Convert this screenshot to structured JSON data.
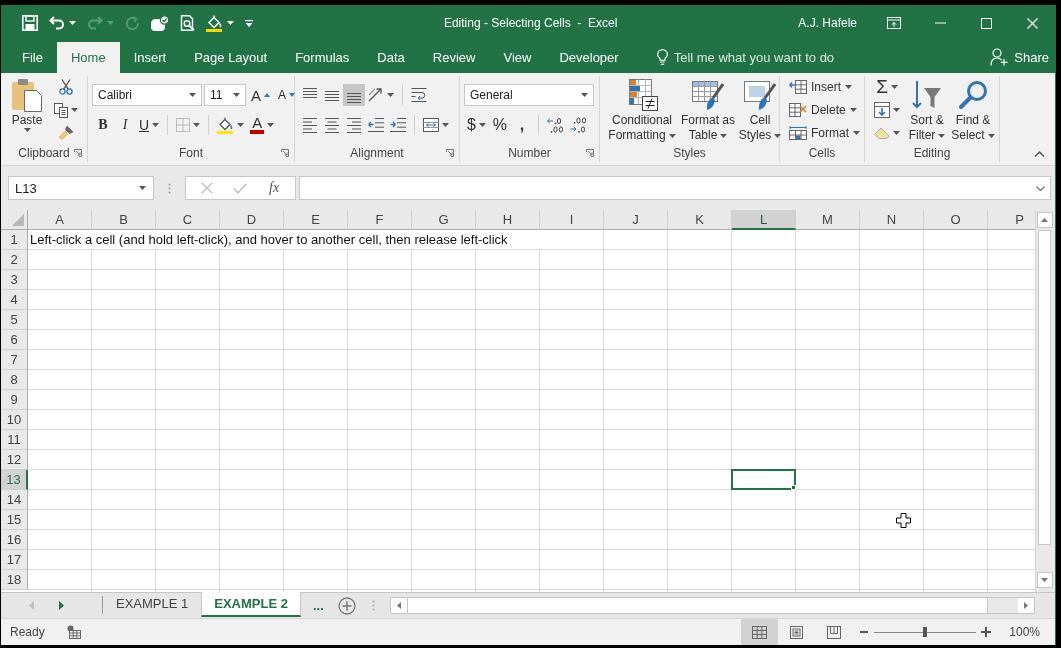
{
  "window": {
    "title": "Editing - Selecting Cells  -  Excel",
    "user": "A.J. Hafele"
  },
  "quick_access": [
    {
      "kind": "save",
      "disabled": false
    },
    {
      "kind": "undo",
      "disabled": false
    },
    {
      "kind": "redo",
      "disabled": true
    },
    {
      "kind": "repeat",
      "disabled": true
    },
    {
      "kind": "touch",
      "disabled": false
    },
    {
      "kind": "preview",
      "disabled": false
    },
    {
      "kind": "fill",
      "disabled": false
    },
    {
      "kind": "customize",
      "disabled": false
    }
  ],
  "ribbon_tabs": [
    {
      "label": "File",
      "selected": false
    },
    {
      "label": "Home",
      "selected": true
    },
    {
      "label": "Insert",
      "selected": false
    },
    {
      "label": "Page Layout",
      "selected": false
    },
    {
      "label": "Formulas",
      "selected": false
    },
    {
      "label": "Data",
      "selected": false
    },
    {
      "label": "Review",
      "selected": false
    },
    {
      "label": "View",
      "selected": false
    },
    {
      "label": "Developer",
      "selected": false
    }
  ],
  "tell_me": {
    "placeholder": "Tell me what you want to do"
  },
  "share": "Share",
  "ribbon": {
    "clipboard": {
      "label": "Clipboard",
      "paste": "Paste"
    },
    "font": {
      "label": "Font",
      "name": "Calibri",
      "size": "11",
      "grow_label": "A",
      "shrink_label": "A",
      "bold_label": "B",
      "italic_label": "I",
      "underline_label": "U",
      "font_color_label": "A"
    },
    "alignment": {
      "label": "Alignment",
      "vertical": [
        {
          "kind": "top",
          "selected": false
        },
        {
          "kind": "middle",
          "selected": false
        },
        {
          "kind": "bottom",
          "selected": true
        }
      ],
      "horizontal": [
        {
          "kind": "left",
          "selected": false
        },
        {
          "kind": "center",
          "selected": false
        },
        {
          "kind": "right",
          "selected": false
        }
      ]
    },
    "number": {
      "label": "Number",
      "format": "General",
      "currency": "$",
      "percent": "%",
      "comma": ","
    },
    "styles": {
      "label": "Styles",
      "buttons": [
        {
          "kind": "conditional",
          "lines": [
            "Conditional",
            "Formatting"
          ]
        },
        {
          "kind": "table",
          "lines": [
            "Format as",
            "Table"
          ]
        },
        {
          "kind": "cell",
          "lines": [
            "Cell",
            "Styles"
          ]
        }
      ]
    },
    "cells": {
      "label": "Cells",
      "buttons": [
        {
          "kind": "insert",
          "label": "Insert"
        },
        {
          "kind": "delete",
          "label": "Delete"
        },
        {
          "kind": "format",
          "label": "Format"
        }
      ]
    },
    "editing": {
      "label": "Editing",
      "autosum": "Σ",
      "sort": [
        "Sort &",
        "Filter"
      ],
      "find": [
        "Find &",
        "Select"
      ]
    }
  },
  "formula_bar": {
    "name_box": "L13",
    "buttons": [
      {
        "kind": "cancel",
        "disabled": true
      },
      {
        "kind": "enter",
        "disabled": true
      }
    ],
    "function_label": "fx"
  },
  "sheet": {
    "columns": [
      {
        "label": "A",
        "selected": false
      },
      {
        "label": "B",
        "selected": false
      },
      {
        "label": "C",
        "selected": false
      },
      {
        "label": "D",
        "selected": false
      },
      {
        "label": "E",
        "selected": false
      },
      {
        "label": "F",
        "selected": false
      },
      {
        "label": "G",
        "selected": false
      },
      {
        "label": "H",
        "selected": false
      },
      {
        "label": "I",
        "selected": false
      },
      {
        "label": "J",
        "selected": false
      },
      {
        "label": "K",
        "selected": false
      },
      {
        "label": "L",
        "selected": true
      },
      {
        "label": "M",
        "selected": false
      },
      {
        "label": "N",
        "selected": false
      },
      {
        "label": "O",
        "selected": false
      },
      {
        "label": "P",
        "selected": false
      }
    ],
    "rows": [
      {
        "label": "1",
        "selected": false,
        "text": "Left-click a cell (and hold left-click), and hover to another cell, then release left-click"
      },
      {
        "label": "2",
        "selected": false
      },
      {
        "label": "3",
        "selected": false
      },
      {
        "label": "4",
        "selected": false
      },
      {
        "label": "5",
        "selected": false
      },
      {
        "label": "6",
        "selected": false
      },
      {
        "label": "7",
        "selected": false
      },
      {
        "label": "8",
        "selected": false
      },
      {
        "label": "9",
        "selected": false
      },
      {
        "label": "10",
        "selected": false
      },
      {
        "label": "11",
        "selected": false
      },
      {
        "label": "12",
        "selected": false
      },
      {
        "label": "13",
        "selected": true
      },
      {
        "label": "14",
        "selected": false
      },
      {
        "label": "15",
        "selected": false
      },
      {
        "label": "16",
        "selected": false
      },
      {
        "label": "17",
        "selected": false
      },
      {
        "label": "18",
        "selected": false
      }
    ]
  },
  "sheet_nav": [
    {
      "kind": "previous",
      "disabled": true
    },
    {
      "kind": "next",
      "disabled": false
    }
  ],
  "sheet_tabs": [
    {
      "label": "EXAMPLE 1",
      "selected": false
    },
    {
      "label": "EXAMPLE 2",
      "selected": true
    }
  ],
  "more_sheets": "...",
  "status_bar": {
    "status": "Ready",
    "views": [
      {
        "kind": "normal",
        "selected": true
      },
      {
        "kind": "layout",
        "selected": false
      },
      {
        "kind": "break",
        "selected": false
      }
    ],
    "zoom": {
      "level": 0.5,
      "reading": "100%"
    }
  }
}
